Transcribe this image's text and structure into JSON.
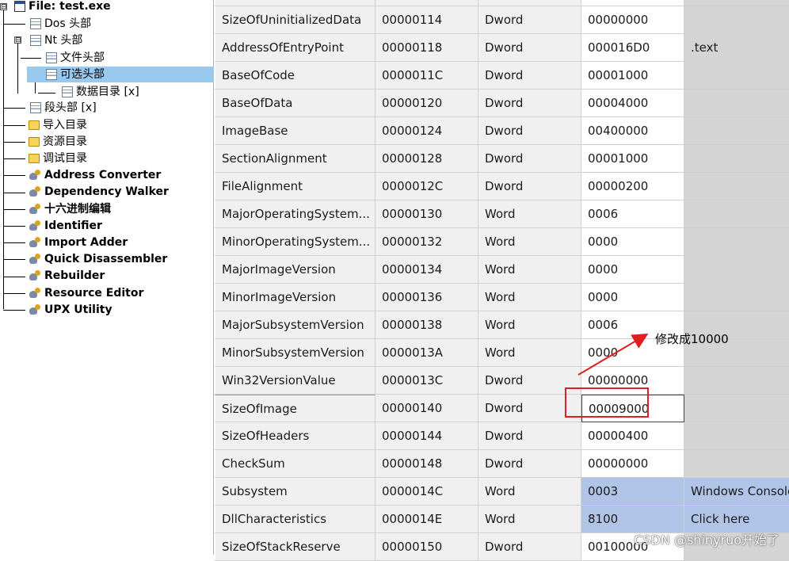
{
  "tree": {
    "items": [
      {
        "label": "File: test.exe",
        "icon": "window-icon"
      },
      {
        "label": "Dos 头部",
        "icon": "document-icon"
      },
      {
        "label": "Nt 头部",
        "icon": "document-icon"
      },
      {
        "label": "文件头部",
        "icon": "document-icon"
      },
      {
        "label": "可选头部",
        "icon": "document-icon"
      },
      {
        "label": "数据目录 [x]",
        "icon": "document-icon"
      },
      {
        "label": "段头部 [x]",
        "icon": "document-icon"
      },
      {
        "label": "导入目录",
        "icon": "folder-icon"
      },
      {
        "label": "资源目录",
        "icon": "folder-icon"
      },
      {
        "label": "调试目录",
        "icon": "folder-icon"
      },
      {
        "label": "Address Converter",
        "icon": "tool-icon"
      },
      {
        "label": "Dependency Walker",
        "icon": "tool-icon"
      },
      {
        "label": "十六进制编辑",
        "icon": "tool-icon"
      },
      {
        "label": "Identifier",
        "icon": "tool-icon"
      },
      {
        "label": "Import Adder",
        "icon": "tool-icon"
      },
      {
        "label": "Quick Disassembler",
        "icon": "tool-icon"
      },
      {
        "label": "Rebuilder",
        "icon": "tool-icon"
      },
      {
        "label": "Resource Editor",
        "icon": "tool-icon"
      },
      {
        "label": "UPX Utility",
        "icon": "tool-icon"
      }
    ],
    "expanders": [
      "⊟",
      "⊟",
      "⊟"
    ]
  },
  "grid": {
    "rows": [
      {
        "name": "SizeOfUninitializedData",
        "offset": "00000114",
        "size": "Dword",
        "value": "00000000",
        "meaning": ""
      },
      {
        "name": "AddressOfEntryPoint",
        "offset": "00000118",
        "size": "Dword",
        "value": "000016D0",
        "meaning": ".text"
      },
      {
        "name": "BaseOfCode",
        "offset": "0000011C",
        "size": "Dword",
        "value": "00001000",
        "meaning": ""
      },
      {
        "name": "BaseOfData",
        "offset": "00000120",
        "size": "Dword",
        "value": "00004000",
        "meaning": ""
      },
      {
        "name": "ImageBase",
        "offset": "00000124",
        "size": "Dword",
        "value": "00400000",
        "meaning": ""
      },
      {
        "name": "SectionAlignment",
        "offset": "00000128",
        "size": "Dword",
        "value": "00001000",
        "meaning": ""
      },
      {
        "name": "FileAlignment",
        "offset": "0000012C",
        "size": "Dword",
        "value": "00000200",
        "meaning": ""
      },
      {
        "name": "MajorOperatingSystem...",
        "offset": "00000130",
        "size": "Word",
        "value": "0006",
        "meaning": ""
      },
      {
        "name": "MinorOperatingSystem...",
        "offset": "00000132",
        "size": "Word",
        "value": "0000",
        "meaning": ""
      },
      {
        "name": "MajorImageVersion",
        "offset": "00000134",
        "size": "Word",
        "value": "0000",
        "meaning": ""
      },
      {
        "name": "MinorImageVersion",
        "offset": "00000136",
        "size": "Word",
        "value": "0000",
        "meaning": ""
      },
      {
        "name": "MajorSubsystemVersion",
        "offset": "00000138",
        "size": "Word",
        "value": "0006",
        "meaning": ""
      },
      {
        "name": "MinorSubsystemVersion",
        "offset": "0000013A",
        "size": "Word",
        "value": "0000",
        "meaning": ""
      },
      {
        "name": "Win32VersionValue",
        "offset": "0000013C",
        "size": "Dword",
        "value": "00000000",
        "meaning": ""
      },
      {
        "name": "SizeOfImage",
        "offset": "00000140",
        "size": "Dword",
        "value": "00009000",
        "meaning": ""
      },
      {
        "name": "SizeOfHeaders",
        "offset": "00000144",
        "size": "Dword",
        "value": "00000400",
        "meaning": ""
      },
      {
        "name": "CheckSum",
        "offset": "00000148",
        "size": "Dword",
        "value": "00000000",
        "meaning": ""
      },
      {
        "name": "Subsystem",
        "offset": "0000014C",
        "size": "Word",
        "value": "0003",
        "meaning": "Windows Console"
      },
      {
        "name": "DllCharacteristics",
        "offset": "0000014E",
        "size": "Word",
        "value": "8100",
        "meaning": "Click here"
      },
      {
        "name": "SizeOfStackReserve",
        "offset": "00000150",
        "size": "Dword",
        "value": "00100000",
        "meaning": ""
      }
    ]
  },
  "annotation": {
    "note": "修改成10000",
    "color": "#e02020"
  },
  "watermark": "CSDN @shinyruo开始了",
  "colors": {
    "selection": "#99c9ef",
    "highlight": "#b0c4e8"
  }
}
